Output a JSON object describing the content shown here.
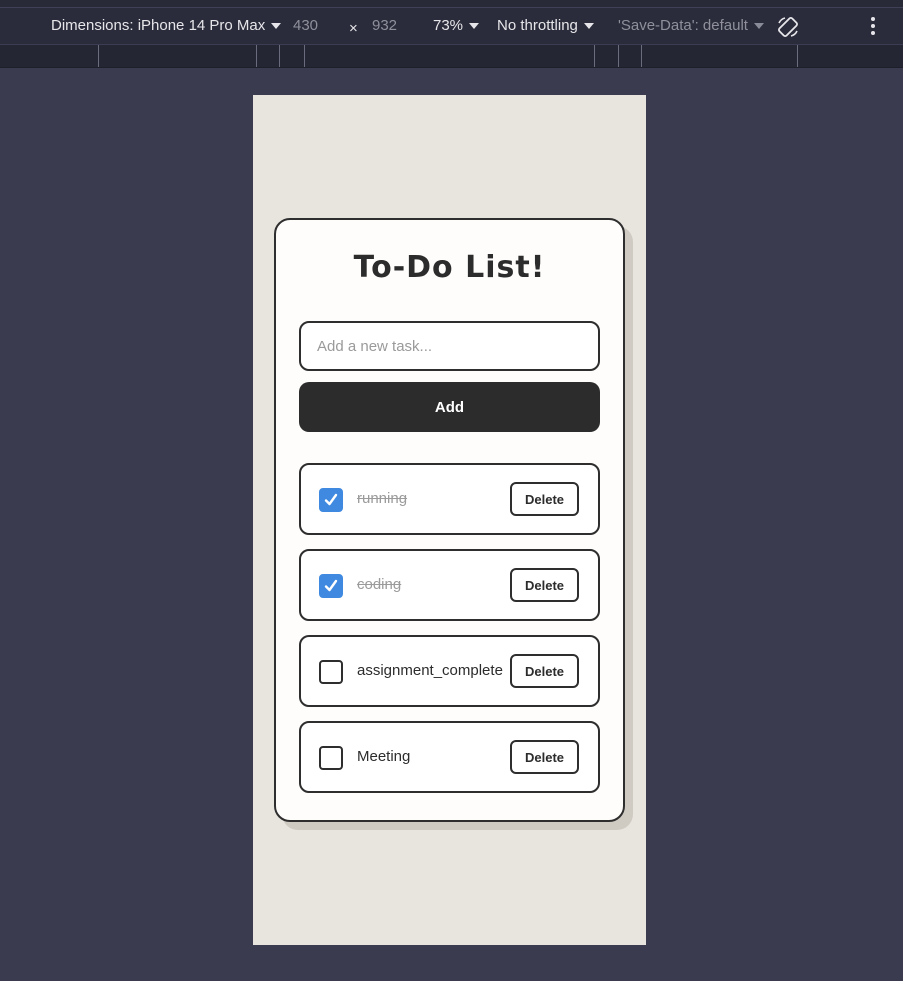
{
  "devtools": {
    "dimensions_label": "Dimensions: iPhone 14 Pro Max",
    "width": "430",
    "times": "×",
    "height": "932",
    "zoom": "73%",
    "throttling": "No throttling",
    "save_data": "'Save-Data': default"
  },
  "app": {
    "title": "To-Do List!",
    "input_placeholder": "Add a new task...",
    "add_label": "Add",
    "delete_label": "Delete",
    "tasks": [
      {
        "label": "running",
        "done": true
      },
      {
        "label": "coding",
        "done": true
      },
      {
        "label": "assignment_complete",
        "done": false
      },
      {
        "label": "Meeting",
        "done": false
      }
    ]
  },
  "colors": {
    "checked": "#3f8ae0",
    "page_bg": "#e8e4de",
    "devtools_bg": "#3a3b4f"
  }
}
